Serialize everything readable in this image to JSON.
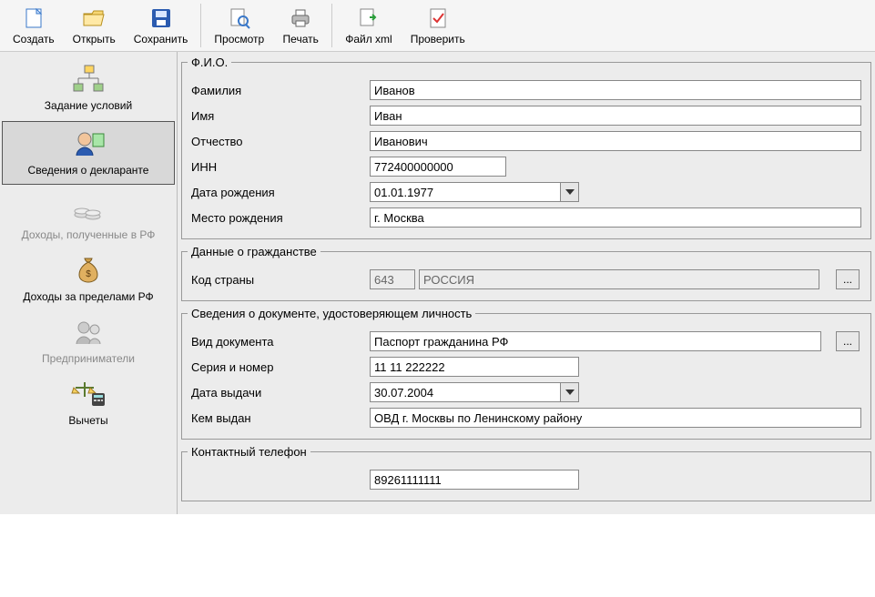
{
  "toolbar": {
    "create": "Создать",
    "open": "Открыть",
    "save": "Сохранить",
    "preview": "Просмотр",
    "print": "Печать",
    "xml": "Файл xml",
    "check": "Проверить"
  },
  "sidebar": {
    "conditions": "Задание условий",
    "declarant": "Сведения о декларанте",
    "income_rf": "Доходы, полученные в РФ",
    "income_abroad": "Доходы за пределами РФ",
    "entrepreneurs": "Предприниматели",
    "deductions": "Вычеты"
  },
  "fio": {
    "legend": "Ф.И.О.",
    "lastname_l": "Фамилия",
    "lastname": "Иванов",
    "firstname_l": "Имя",
    "firstname": "Иван",
    "middle_l": "Отчество",
    "middle": "Иванович",
    "inn_l": "ИНН",
    "inn": "772400000000",
    "dob_l": "Дата рождения",
    "dob": "01.01.1977",
    "pob_l": "Место рождения",
    "pob": "г. Москва"
  },
  "citizen": {
    "legend": "Данные о гражданстве",
    "code_l": "Код страны",
    "code": "643",
    "country": "РОССИЯ",
    "btn": "..."
  },
  "doc": {
    "legend": "Сведения о документе, удостоверяющем личность",
    "type_l": "Вид документа",
    "type": "Паспорт гражданина РФ",
    "serial_l": "Серия и номер",
    "serial": "11 11 222222",
    "issued_l": "Дата выдачи",
    "issued": "30.07.2004",
    "by_l": "Кем выдан",
    "by": "ОВД г. Москвы по Ленинскому району",
    "btn": "..."
  },
  "contact": {
    "legend": "Контактный телефон",
    "phone": "89261111111"
  }
}
